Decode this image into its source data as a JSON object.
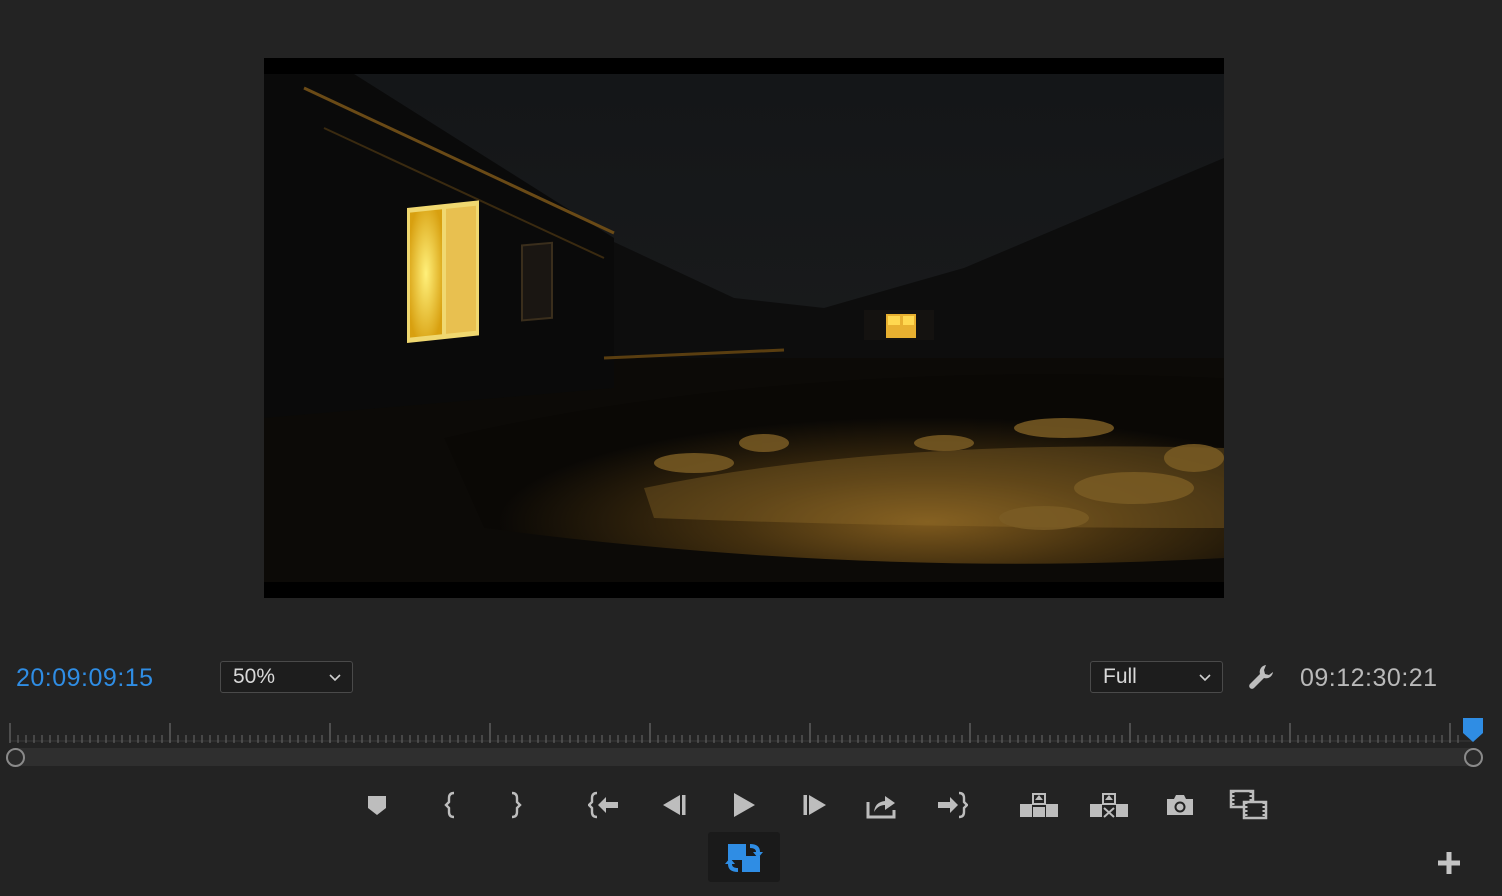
{
  "monitor": {
    "current_timecode": "20:09:09:15",
    "duration_timecode": "09:12:30:21",
    "zoom": {
      "value": "50%"
    },
    "quality": {
      "value": "Full"
    }
  },
  "icons": {
    "settings": "wrench-icon",
    "add_marker": "marker-icon",
    "mark_in": "mark-in-icon",
    "mark_out": "mark-out-icon",
    "go_to_in": "go-to-in-icon",
    "step_back": "step-back-icon",
    "play": "play-icon",
    "step_forward": "step-forward-icon",
    "export": "export-icon",
    "go_to_out": "go-to-out-icon",
    "lift": "lift-icon",
    "extract": "extract-icon",
    "camera": "camera-icon",
    "comparison": "comparison-view-icon",
    "loop": "loop-icon",
    "add": "plus-icon"
  },
  "colors": {
    "accent": "#2f8de4",
    "background": "#232323",
    "icon": "#bdbdbd"
  },
  "playhead_position": 1.0
}
